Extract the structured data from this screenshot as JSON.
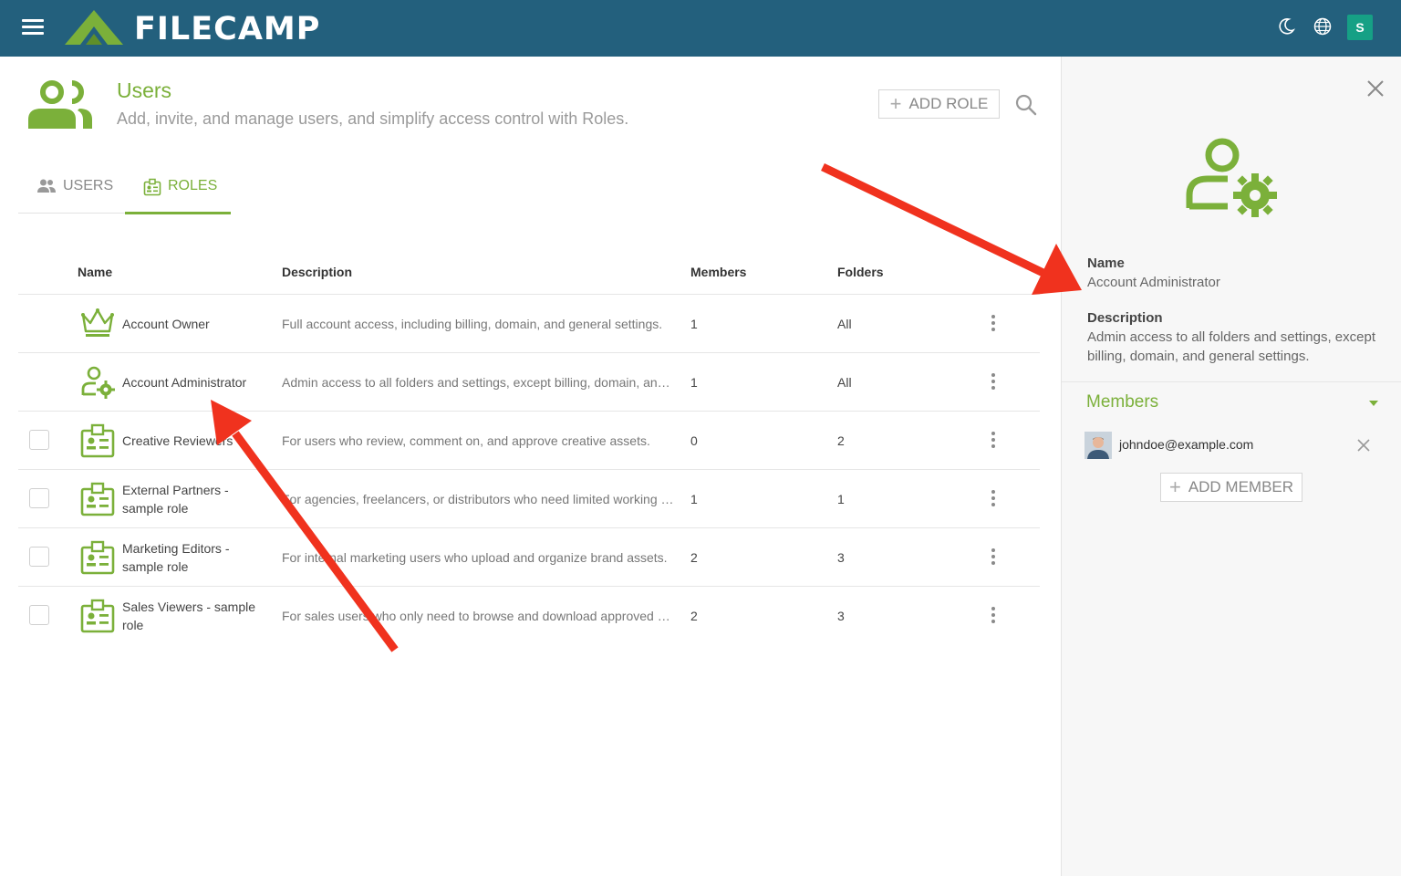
{
  "app": {
    "brand": "FILECAMP",
    "avatar_initial": "S"
  },
  "header": {
    "title": "Users",
    "subtitle": "Add, invite, and manage users, and simplify access control with Roles.",
    "add_role_label": "ADD ROLE"
  },
  "tabs": [
    {
      "label": "USERS",
      "active": false
    },
    {
      "label": "ROLES",
      "active": true
    }
  ],
  "table": {
    "columns": [
      "Name",
      "Description",
      "Members",
      "Folders"
    ],
    "rows": [
      {
        "icon": "crown-icon",
        "name": "Account Owner",
        "description": "Full account access, including billing, domain, and general settings.",
        "members": "1",
        "folders": "All",
        "checkbox": false
      },
      {
        "icon": "user-gear-icon",
        "name": "Account Administrator",
        "description": "Admin access to all folders and settings, except billing, domain, and general settings.",
        "members": "1",
        "folders": "All",
        "checkbox": false
      },
      {
        "icon": "badge-icon",
        "name": "Creative Reviewers",
        "description": "For users who review, comment on, and approve creative assets.",
        "members": "0",
        "folders": "2",
        "checkbox": true
      },
      {
        "icon": "badge-icon",
        "name_line1": "External Partners -",
        "name_line2": "sample role",
        "description": "For agencies, freelancers, or distributors who need limited working access.",
        "members": "1",
        "folders": "1",
        "checkbox": true
      },
      {
        "icon": "badge-icon",
        "name_line1": "Marketing Editors -",
        "name_line2": "sample role",
        "description": "For internal marketing users who upload and organize brand assets.",
        "members": "2",
        "folders": "3",
        "checkbox": true
      },
      {
        "icon": "badge-icon",
        "name_line1": "Sales Viewers - sample",
        "name_line2": "role",
        "description": "For sales users who only need to browse and download approved materials.",
        "members": "2",
        "folders": "3",
        "checkbox": true
      }
    ]
  },
  "panel": {
    "name_label": "Name",
    "name_value": "Account Administrator",
    "description_label": "Description",
    "description_line1": "Admin access to all folders and settings, except",
    "description_line2": "billing, domain, and general settings.",
    "members_title": "Members",
    "members": [
      {
        "email": "johndoe@example.com"
      }
    ],
    "add_member_label": "ADD MEMBER"
  },
  "colors": {
    "topbar": "#23607d",
    "accent": "#7bb03a",
    "annotation": "#f0321e"
  }
}
